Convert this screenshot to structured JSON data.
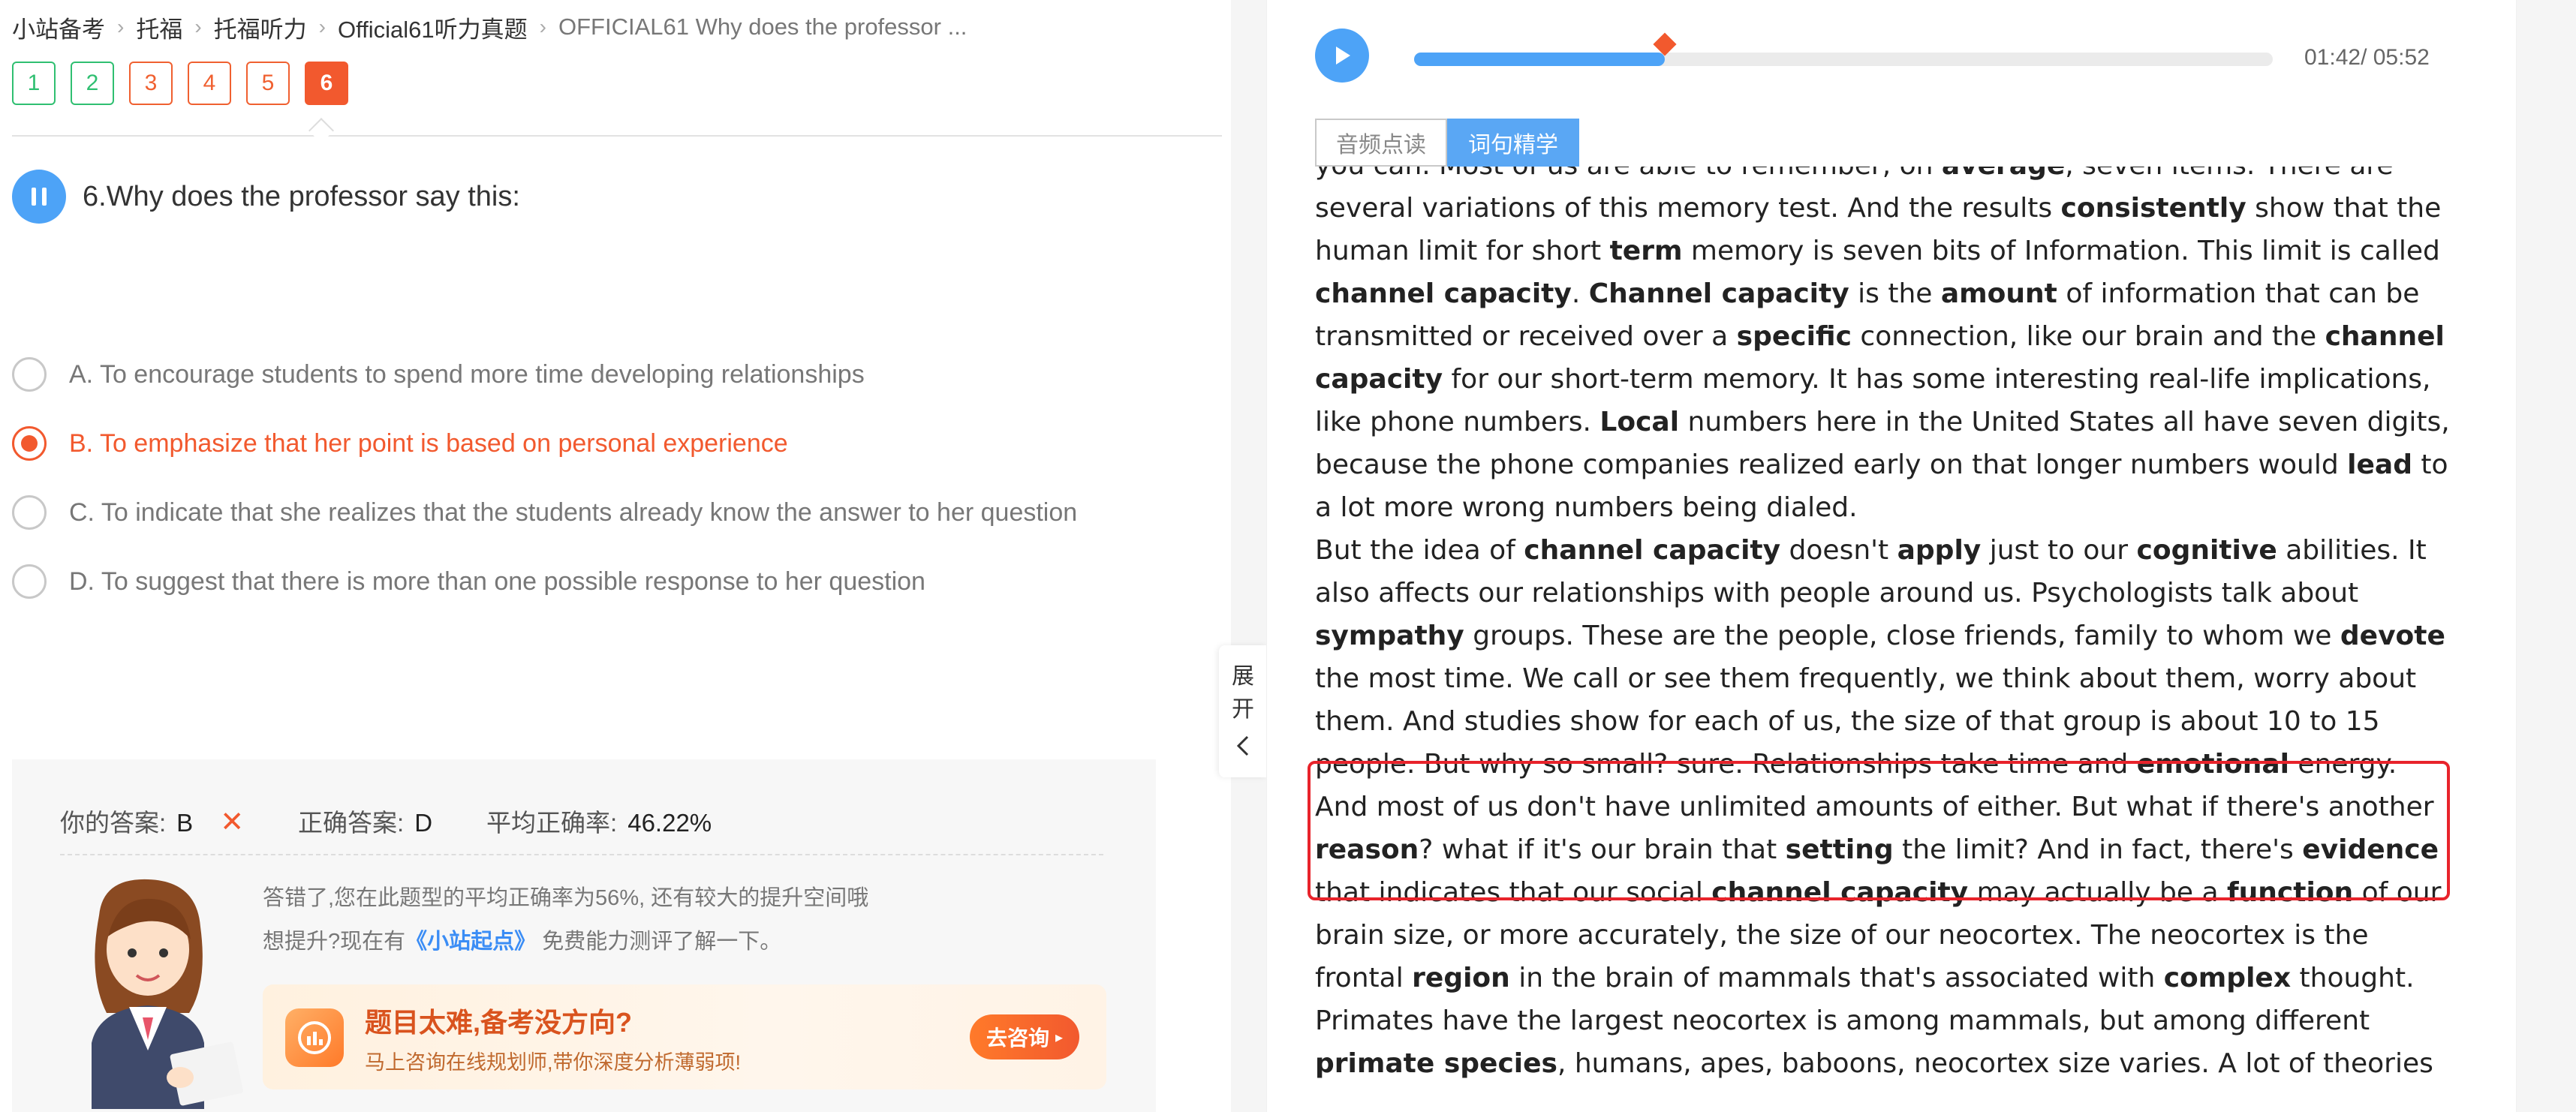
{
  "breadcrumb": {
    "items": [
      "小站备考",
      "托福",
      "托福听力",
      "Official61听力真题",
      "OFFICIAL61 Why does the professor ..."
    ]
  },
  "question_nav": {
    "items": [
      {
        "label": "1",
        "state": "correct"
      },
      {
        "label": "2",
        "state": "correct"
      },
      {
        "label": "3",
        "state": "wrong"
      },
      {
        "label": "4",
        "state": "wrong"
      },
      {
        "label": "5",
        "state": "wrong"
      },
      {
        "label": "6",
        "state": "current"
      }
    ]
  },
  "question": {
    "title": "6.Why does the professor say this:",
    "options": [
      {
        "text": "A. To encourage students to spend more time developing relationships",
        "selected": false
      },
      {
        "text": "B. To emphasize that her point is based on personal experience",
        "selected": true
      },
      {
        "text": "C. To indicate that she realizes that the students already know the answer to her question",
        "selected": false
      },
      {
        "text": "D. To suggest that there is more than one possible response to her question",
        "selected": false
      }
    ]
  },
  "result": {
    "your_answer_label": "你的答案:",
    "your_answer": "B",
    "wrong_mark": "✕",
    "correct_answer_label": "正确答案:",
    "correct_answer": "D",
    "avg_rate_label": "平均正确率:",
    "avg_rate": "46.22%",
    "tip_line1": "答错了,您在此题型的平均正确率为56%, 还有较大的提升空间哦",
    "tip_line2_a": "想提升?现在有",
    "tip_line2_link": "《小站起点》",
    "tip_line2_b": " 免费能力测评了解一下。"
  },
  "promo": {
    "title": "题目太难,备考没方向?",
    "subtitle": "马上咨询在线规划师,带你深度分析薄弱项!",
    "button": "去咨询"
  },
  "expand_handle": {
    "char1": "展",
    "char2": "开"
  },
  "player": {
    "time": "01:42/ 05:52",
    "progress": 0.292
  },
  "tabs": [
    {
      "label": "音频点读",
      "active": false
    },
    {
      "label": "词句精学",
      "active": true
    }
  ],
  "transcript": {
    "lines": [
      [
        {
          "t": "you can. Most of us are able to remember, on "
        },
        {
          "t": "average",
          "b": true
        },
        {
          "t": ", seven items. There are"
        }
      ],
      [
        {
          "t": "several variations of this memory test. And the results "
        },
        {
          "t": "consistently",
          "b": true
        },
        {
          "t": " show that the"
        }
      ],
      [
        {
          "t": "human limit for short "
        },
        {
          "t": "term",
          "b": true
        },
        {
          "t": " memory is seven bits of Information. This limit is called"
        }
      ],
      [
        {
          "t": "channel capacity",
          "b": true
        },
        {
          "t": ". "
        },
        {
          "t": "Channel capacity",
          "b": true
        },
        {
          "t": " is the "
        },
        {
          "t": "amount",
          "b": true
        },
        {
          "t": " of information that can be"
        }
      ],
      [
        {
          "t": "transmitted or received over a "
        },
        {
          "t": "specific",
          "b": true
        },
        {
          "t": " connection, like our brain and the "
        },
        {
          "t": "channel",
          "b": true
        }
      ],
      [
        {
          "t": "capacity",
          "b": true
        },
        {
          "t": " for our short-term memory. It has some interesting real-life implications,"
        }
      ],
      [
        {
          "t": "like phone numbers. "
        },
        {
          "t": "Local",
          "b": true
        },
        {
          "t": " numbers here in the United States all have seven digits,"
        }
      ],
      [
        {
          "t": "because the phone companies realized early on that longer numbers would "
        },
        {
          "t": "lead",
          "b": true
        },
        {
          "t": " to"
        }
      ],
      [
        {
          "t": "a lot more wrong numbers being dialed."
        }
      ],
      [
        {
          "t": "But the idea of "
        },
        {
          "t": "channel capacity",
          "b": true
        },
        {
          "t": " doesn't "
        },
        {
          "t": "apply",
          "b": true
        },
        {
          "t": " just to our "
        },
        {
          "t": "cognitive",
          "b": true
        },
        {
          "t": " abilities. It"
        }
      ],
      [
        {
          "t": "also affects our relationships with people around us. Psychologists talk about"
        }
      ],
      [
        {
          "t": "sympathy",
          "b": true
        },
        {
          "t": " groups. These are the people, close friends, family to whom we "
        },
        {
          "t": "devote",
          "b": true
        }
      ],
      [
        {
          "t": "the most time. We call or see them frequently, we think about them, worry about"
        }
      ],
      [
        {
          "t": "them. And studies show for each of us, the size of that group is about 10 to 15"
        }
      ],
      [
        {
          "t": "people. But why so small? sure. Relationships take time and "
        },
        {
          "t": "emotional",
          "b": true
        },
        {
          "t": " energy."
        }
      ],
      [
        {
          "t": "And most of us don't have unlimited amounts of either. But what if there's another"
        }
      ],
      [
        {
          "t": "reason",
          "b": true
        },
        {
          "t": "? what if it's our brain that "
        },
        {
          "t": "setting",
          "b": true
        },
        {
          "t": " the limit? And in fact, there's "
        },
        {
          "t": "evidence",
          "b": true
        }
      ],
      [
        {
          "t": "that indicates that our social "
        },
        {
          "t": "channel capacity",
          "b": true
        },
        {
          "t": " may actually be a "
        },
        {
          "t": "function",
          "b": true
        },
        {
          "t": " of our"
        }
      ],
      [
        {
          "t": "brain size, or more accurately, the size of our neocortex. The neocortex is the"
        }
      ],
      [
        {
          "t": "frontal "
        },
        {
          "t": "region",
          "b": true
        },
        {
          "t": " in the brain of mammals that's associated with "
        },
        {
          "t": "complex",
          "b": true
        },
        {
          "t": " thought."
        }
      ],
      [
        {
          "t": "Primates have the largest neocortex is among mammals, but among different"
        }
      ],
      [
        {
          "t": "primate species",
          "b": true
        },
        {
          "t": ", humans, apes, baboons, neocortex size varies. A lot of theories"
        }
      ]
    ]
  },
  "colors": {
    "accent_blue": "#4da3f7",
    "accent_orange": "#f2592e",
    "correct_green": "#2fbf71",
    "highlight_red": "#e8232b"
  }
}
